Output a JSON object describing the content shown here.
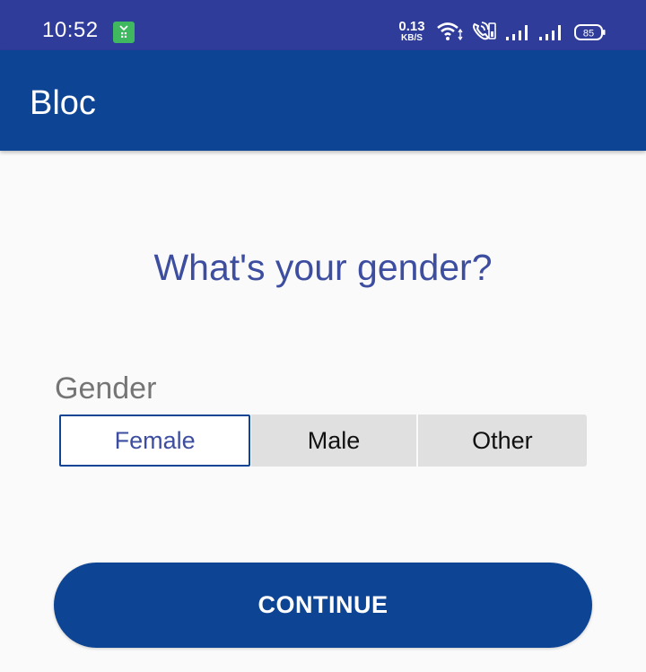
{
  "status_bar": {
    "time": "10:52",
    "net_speed_value": "0.13",
    "net_speed_unit": "KB/S",
    "battery_level": "85",
    "icons": [
      "notification-icon",
      "wifi-icon",
      "volte-call-icon",
      "signal-icon",
      "signal-icon",
      "battery-icon"
    ]
  },
  "app_bar": {
    "title": "Bloc"
  },
  "main": {
    "question": "What's your gender?",
    "field_label": "Gender",
    "options": [
      {
        "label": "Female",
        "selected": true
      },
      {
        "label": "Male",
        "selected": false
      },
      {
        "label": "Other",
        "selected": false
      }
    ],
    "continue_label": "CONTINUE"
  },
  "colors": {
    "status_bar": "#2f3c9a",
    "app_bar": "#0d4494",
    "question_text": "#3d4ea0",
    "segment_unselected": "#e0e0e0",
    "background": "#fafafa"
  }
}
